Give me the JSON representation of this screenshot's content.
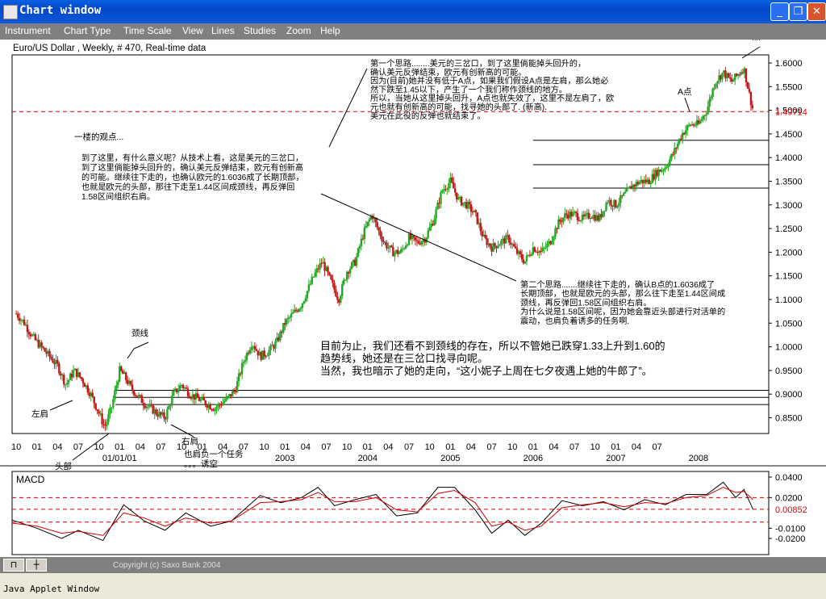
{
  "window": {
    "title": "Chart window",
    "buttons": {
      "minimize": "_",
      "maximize": "❐",
      "close": "✕"
    }
  },
  "menu": [
    "Instrument",
    "Chart Type",
    "Time Scale",
    "View",
    "Lines",
    "Studies",
    "Zoom",
    "Help"
  ],
  "chart_header": "Euro/US Dollar , Weekly, # 470, Real-time data",
  "chart_data": [
    {
      "type": "candlestick",
      "title": "Euro/US Dollar , Weekly, # 470, Real-time data",
      "ylim": [
        0.82,
        1.62
      ],
      "y_ticks": [
        "0.8500",
        "0.9000",
        "0.9500",
        "1.0000",
        "1.0500",
        "1.1000",
        "1.1500",
        "1.2000",
        "1.2500",
        "1.3000",
        "1.3500",
        "1.4000",
        "1.4500",
        "1.5000",
        "1.5500",
        "1.6000"
      ],
      "current_price": "1.49714",
      "x_tick_labels": [
        "10",
        "01",
        "04",
        "07",
        "10",
        "01",
        "04",
        "07",
        "10",
        "01",
        "04",
        "07",
        "10",
        "01",
        "04",
        "07",
        "10",
        "01",
        "04",
        "07",
        "10",
        "01",
        "04",
        "07",
        "10",
        "01",
        "04",
        "07",
        "10",
        "01",
        "04",
        "07"
      ],
      "year_labels": [
        "01/01/01",
        "2003",
        "2004",
        "2005",
        "2006",
        "2007",
        "2008"
      ],
      "price_path": [
        [
          1999.75,
          1.07
        ],
        [
          1999.85,
          1.05
        ],
        [
          1999.95,
          1.02
        ],
        [
          2000.1,
          0.99
        ],
        [
          2000.25,
          0.96
        ],
        [
          2000.35,
          0.92
        ],
        [
          2000.45,
          0.95
        ],
        [
          2000.55,
          0.93
        ],
        [
          2000.65,
          0.9
        ],
        [
          2000.75,
          0.86
        ],
        [
          2000.82,
          0.83
        ],
        [
          2000.9,
          0.87
        ],
        [
          2001.0,
          0.95
        ],
        [
          2001.05,
          0.94
        ],
        [
          2001.15,
          0.91
        ],
        [
          2001.3,
          0.88
        ],
        [
          2001.45,
          0.86
        ],
        [
          2001.55,
          0.85
        ],
        [
          2001.65,
          0.9
        ],
        [
          2001.75,
          0.92
        ],
        [
          2001.85,
          0.9
        ],
        [
          2001.95,
          0.89
        ],
        [
          2002.05,
          0.88
        ],
        [
          2002.15,
          0.87
        ],
        [
          2002.3,
          0.89
        ],
        [
          2002.4,
          0.91
        ],
        [
          2002.5,
          0.97
        ],
        [
          2002.6,
          1.01
        ],
        [
          2002.7,
          0.98
        ],
        [
          2002.8,
          0.99
        ],
        [
          2002.9,
          1.01
        ],
        [
          2003.0,
          1.05
        ],
        [
          2003.1,
          1.07
        ],
        [
          2003.2,
          1.09
        ],
        [
          2003.35,
          1.15
        ],
        [
          2003.45,
          1.18
        ],
        [
          2003.55,
          1.14
        ],
        [
          2003.65,
          1.1
        ],
        [
          2003.75,
          1.16
        ],
        [
          2003.85,
          1.18
        ],
        [
          2003.95,
          1.24
        ],
        [
          2004.05,
          1.28
        ],
        [
          2004.12,
          1.25
        ],
        [
          2004.2,
          1.22
        ],
        [
          2004.3,
          1.2
        ],
        [
          2004.4,
          1.2
        ],
        [
          2004.5,
          1.23
        ],
        [
          2004.6,
          1.22
        ],
        [
          2004.7,
          1.23
        ],
        [
          2004.8,
          1.27
        ],
        [
          2004.9,
          1.33
        ],
        [
          2005.0,
          1.35
        ],
        [
          2005.1,
          1.31
        ],
        [
          2005.2,
          1.3
        ],
        [
          2005.3,
          1.28
        ],
        [
          2005.4,
          1.23
        ],
        [
          2005.5,
          1.21
        ],
        [
          2005.6,
          1.22
        ],
        [
          2005.7,
          1.23
        ],
        [
          2005.8,
          1.2
        ],
        [
          2005.9,
          1.18
        ],
        [
          2006.0,
          1.21
        ],
        [
          2006.1,
          1.2
        ],
        [
          2006.2,
          1.22
        ],
        [
          2006.3,
          1.26
        ],
        [
          2006.4,
          1.28
        ],
        [
          2006.5,
          1.28
        ],
        [
          2006.6,
          1.27
        ],
        [
          2006.7,
          1.28
        ],
        [
          2006.8,
          1.27
        ],
        [
          2006.9,
          1.31
        ],
        [
          2007.0,
          1.3
        ],
        [
          2007.1,
          1.32
        ],
        [
          2007.2,
          1.34
        ],
        [
          2007.3,
          1.35
        ],
        [
          2007.4,
          1.35
        ],
        [
          2007.5,
          1.37
        ],
        [
          2007.6,
          1.38
        ],
        [
          2007.7,
          1.41
        ],
        [
          2007.8,
          1.45
        ],
        [
          2007.9,
          1.47
        ],
        [
          2008.0,
          1.47
        ],
        [
          2008.1,
          1.5
        ],
        [
          2008.2,
          1.56
        ],
        [
          2008.3,
          1.58
        ],
        [
          2008.4,
          1.56
        ],
        [
          2008.5,
          1.58
        ],
        [
          2008.55,
          1.59
        ],
        [
          2008.62,
          1.53
        ],
        [
          2008.66,
          1.5
        ]
      ],
      "x_range": [
        1999.7,
        2008.85
      ],
      "horizontal_levels": [
        {
          "y": 1.49714,
          "style": "dashed-red",
          "x_from": 1999.7
        },
        {
          "y": 1.4366,
          "style": "solid",
          "x_from": 2006.0
        },
        {
          "y": 1.3849,
          "style": "solid",
          "x_from": 2006.0
        },
        {
          "y": 1.3354,
          "style": "solid",
          "x_from": 2006.0
        },
        {
          "y": 0.908,
          "style": "solid",
          "x_from": 2000.95
        },
        {
          "y": 0.893,
          "style": "solid",
          "x_from": 2000.95
        },
        {
          "y": 0.878,
          "style": "solid",
          "x_from": 2000.95
        }
      ]
    },
    {
      "type": "line",
      "title": "MACD",
      "ylim": [
        -0.03,
        0.05
      ],
      "y_ticks": [
        "0.0400",
        "0.0200",
        "-0.0100",
        "-0.0200"
      ],
      "current_value": "0.00852",
      "dashed_levels": [
        0.02,
        0.00852,
        -0.004
      ],
      "series": [
        {
          "color": "#000000",
          "values": [
            [
              1999.7,
              -0.002
            ],
            [
              2000.0,
              -0.01
            ],
            [
              2000.3,
              -0.02
            ],
            [
              2000.5,
              -0.012
            ],
            [
              2000.8,
              -0.022
            ],
            [
              2001.05,
              0.013
            ],
            [
              2001.3,
              -0.003
            ],
            [
              2001.55,
              -0.012
            ],
            [
              2001.8,
              0.005
            ],
            [
              2002.1,
              -0.008
            ],
            [
              2002.35,
              -0.003
            ],
            [
              2002.7,
              0.022
            ],
            [
              2002.95,
              0.015
            ],
            [
              2003.2,
              0.02
            ],
            [
              2003.4,
              0.03
            ],
            [
              2003.6,
              0.012
            ],
            [
              2003.85,
              0.018
            ],
            [
              2004.1,
              0.023
            ],
            [
              2004.35,
              0.002
            ],
            [
              2004.6,
              0.005
            ],
            [
              2004.85,
              0.03
            ],
            [
              2005.05,
              0.03
            ],
            [
              2005.3,
              0.008
            ],
            [
              2005.5,
              -0.015
            ],
            [
              2005.7,
              -0.002
            ],
            [
              2005.9,
              -0.017
            ],
            [
              2006.1,
              -0.005
            ],
            [
              2006.35,
              0.017
            ],
            [
              2006.6,
              0.012
            ],
            [
              2006.85,
              0.016
            ],
            [
              2007.1,
              0.008
            ],
            [
              2007.35,
              0.018
            ],
            [
              2007.6,
              0.013
            ],
            [
              2007.85,
              0.023
            ],
            [
              2008.1,
              0.023
            ],
            [
              2008.3,
              0.035
            ],
            [
              2008.45,
              0.02
            ],
            [
              2008.55,
              0.028
            ],
            [
              2008.66,
              0.0085
            ]
          ]
        },
        {
          "color": "#cc0000",
          "values": [
            [
              1999.7,
              -0.005
            ],
            [
              2000.0,
              -0.008
            ],
            [
              2000.3,
              -0.015
            ],
            [
              2000.5,
              -0.013
            ],
            [
              2000.8,
              -0.017
            ],
            [
              2001.05,
              0.005
            ],
            [
              2001.3,
              0.0
            ],
            [
              2001.55,
              -0.008
            ],
            [
              2001.8,
              0.0
            ],
            [
              2002.1,
              -0.005
            ],
            [
              2002.35,
              -0.003
            ],
            [
              2002.7,
              0.015
            ],
            [
              2002.95,
              0.016
            ],
            [
              2003.2,
              0.018
            ],
            [
              2003.4,
              0.025
            ],
            [
              2003.6,
              0.016
            ],
            [
              2003.85,
              0.016
            ],
            [
              2004.1,
              0.02
            ],
            [
              2004.35,
              0.008
            ],
            [
              2004.6,
              0.006
            ],
            [
              2004.85,
              0.024
            ],
            [
              2005.05,
              0.027
            ],
            [
              2005.3,
              0.015
            ],
            [
              2005.5,
              -0.008
            ],
            [
              2005.7,
              -0.004
            ],
            [
              2005.9,
              -0.012
            ],
            [
              2006.1,
              -0.008
            ],
            [
              2006.35,
              0.01
            ],
            [
              2006.6,
              0.013
            ],
            [
              2006.85,
              0.015
            ],
            [
              2007.1,
              0.011
            ],
            [
              2007.35,
              0.015
            ],
            [
              2007.6,
              0.014
            ],
            [
              2007.85,
              0.02
            ],
            [
              2008.1,
              0.022
            ],
            [
              2008.3,
              0.03
            ],
            [
              2008.45,
              0.025
            ],
            [
              2008.55,
              0.026
            ],
            [
              2008.66,
              0.018
            ]
          ]
        }
      ]
    }
  ],
  "annotations": {
    "point_b": "B点",
    "point_a": "A点",
    "neckline": "颈线",
    "left_shoulder": "左肩",
    "head": "头部",
    "right_shoulder": "右肩",
    "right_shoulder_note": [
      "也肩负一个任务",
      "。。。诱空"
    ],
    "note_same_view": "一楼的观点...",
    "note_left": [
      "到了这里，有什么意义呢？从技术上看，这是美元的三岔口，",
      "到了这里倘能掉头回升的，确认美元反弹结束，欧元有创新高",
      "的可能。继续往下走的，也确认欧元的1.6036成了长期顶部，",
      "也就是欧元的头部，那往下走至1.44区间成颈线，再反弹回",
      "1.58区间组织右肩。"
    ],
    "note_top": [
      "第一个思路........美元的三岔口，到了这里倘能掉头回升的，",
      "确认美元反弹结束，欧元有创新高的可能。",
      "因为(目前)她并没有低于A点，如果我们假设A点是左肩，那么她必",
      "然下跌至1.45以下，产生了一个我们称作颈线的地方。",
      "所以，当她从这里掉头回升，A点也就失效了，这里不是左肩了，欧",
      "元也就有创新高的可能，找寻她的头部了. (新高).",
      "美元在此役的反弹也就结束了。"
    ],
    "note_right": [
      "第二个思路.......继续往下走的，确认B点的1.6036成了",
      "长期顶部，也就是欧元的头部，那么往下走至1.44区间成",
      "颈线，再反弹回1.58区间组织右肩。",
      "为什么说是1.58区间呢，因为她会靠近头部进行对活单的",
      "震动，也肩负着诱多的任务啊."
    ],
    "note_center": [
      "目前为止，我们还看不到颈线的存在，所以不管她已跌穿1.33上升到1.60的",
      "趋势线，她还是在三岔口找寻向呢。",
      "当然，我也暗示了她的走向，“这小妮子上周在七夕夜遇上她的牛郎了”。"
    ]
  },
  "toolbar_buttons": [
    "⊓",
    "┼"
  ],
  "copyright": "Copyright (c) Saxo Bank 2004",
  "status": "Java Applet Window",
  "colors": {
    "bull": "#22a822",
    "bear": "#c01818",
    "price_line": "#e02020",
    "macd": "#000000",
    "signal": "#cc0000"
  }
}
